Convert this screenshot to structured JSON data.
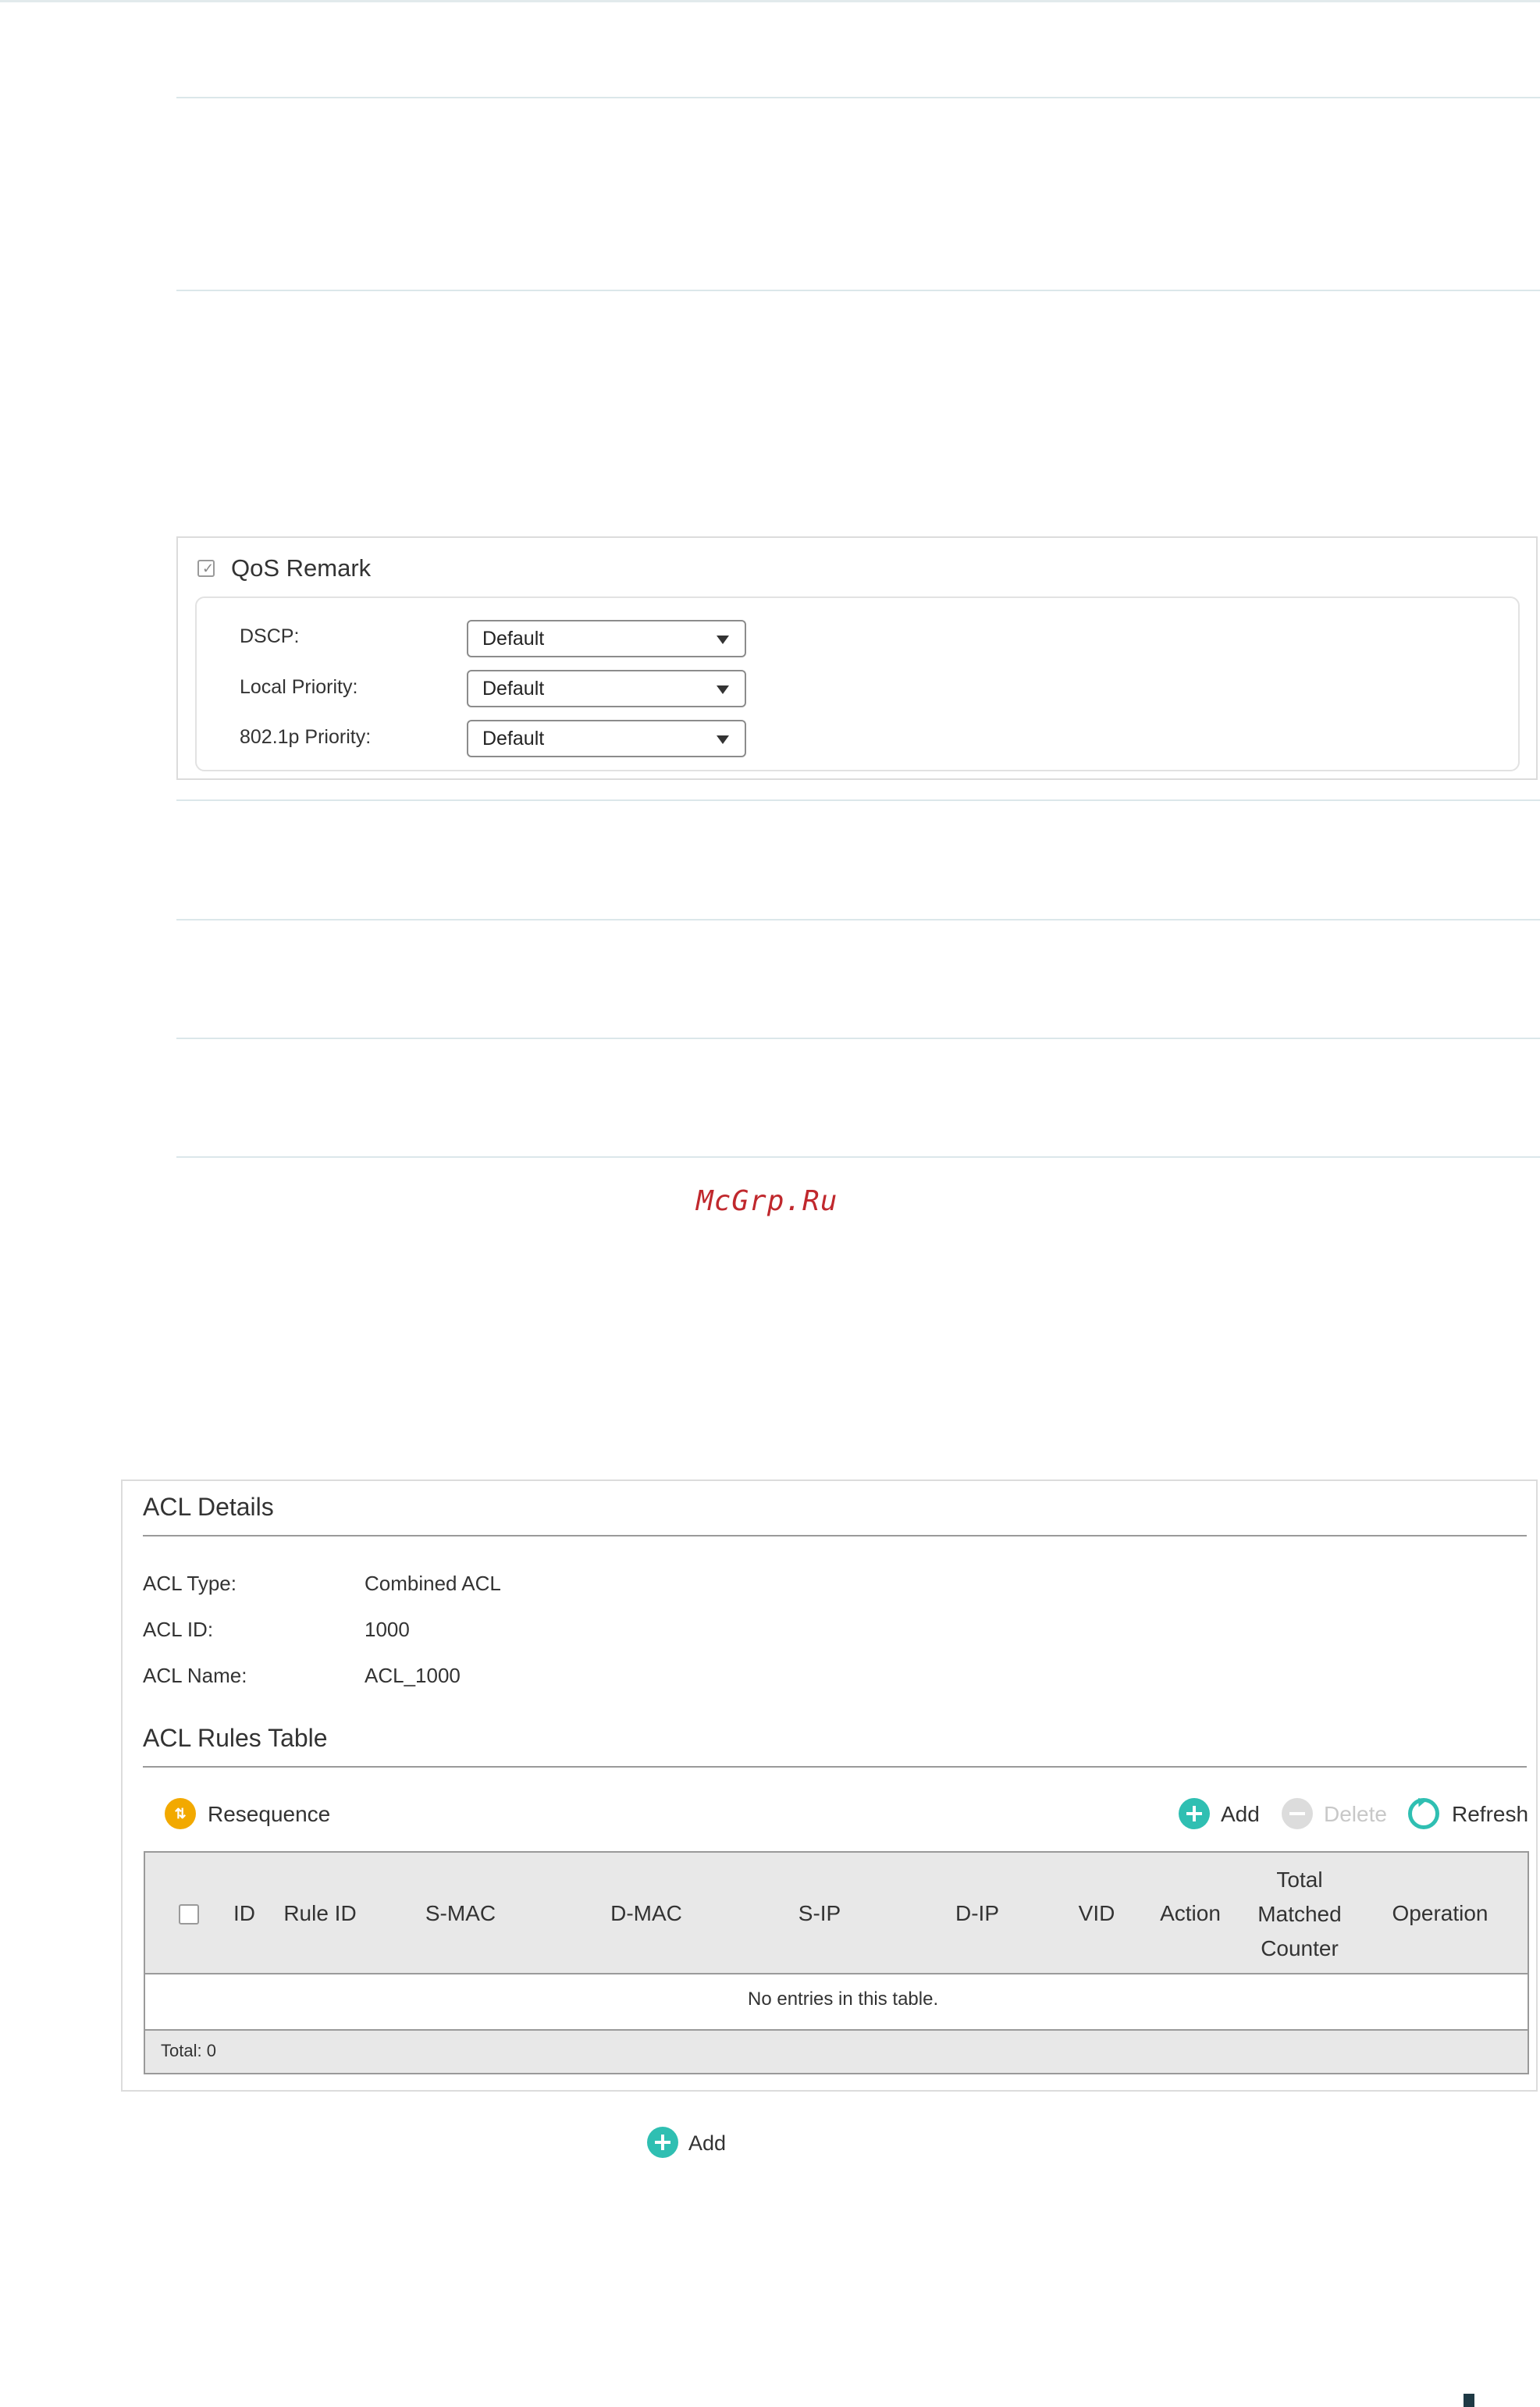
{
  "qos": {
    "checkbox_label": "QoS Remark",
    "checked": true,
    "fields": [
      {
        "label": "DSCP:",
        "value": "Default"
      },
      {
        "label": "Local Priority:",
        "value": "Default"
      },
      {
        "label": "802.1p Priority:",
        "value": "Default"
      }
    ]
  },
  "watermark": "McGrp.Ru",
  "acl": {
    "details_title": "ACL Details",
    "type_label": "ACL Type:",
    "type_value": "Combined ACL",
    "id_label": "ACL ID:",
    "id_value": "1000",
    "name_label": "ACL Name:",
    "name_value": "ACL_1000",
    "rules_title": "ACL Rules Table",
    "toolbar": {
      "resequence": "Resequence",
      "add": "Add",
      "delete": "Delete",
      "refresh": "Refresh"
    },
    "columns": [
      "ID",
      "Rule ID",
      "S-MAC",
      "D-MAC",
      "S-IP",
      "D-IP",
      "VID",
      "Action",
      "Total Matched Counter",
      "Operation"
    ],
    "columns_wrapped": {
      "total_line1": "Total",
      "total_line2": "Matched",
      "total_line3": "Counter"
    },
    "empty_text": "No entries in this table.",
    "total_text": "Total: 0"
  },
  "bottom_add": "Add",
  "colors": {
    "accent": "#2fbfb2",
    "resequence": "#f2a900",
    "watermark": "#c0282d"
  },
  "icons": {
    "add": "plus-circle-icon",
    "delete": "minus-circle-icon",
    "refresh": "refresh-icon",
    "resequence": "resequence-icon"
  }
}
